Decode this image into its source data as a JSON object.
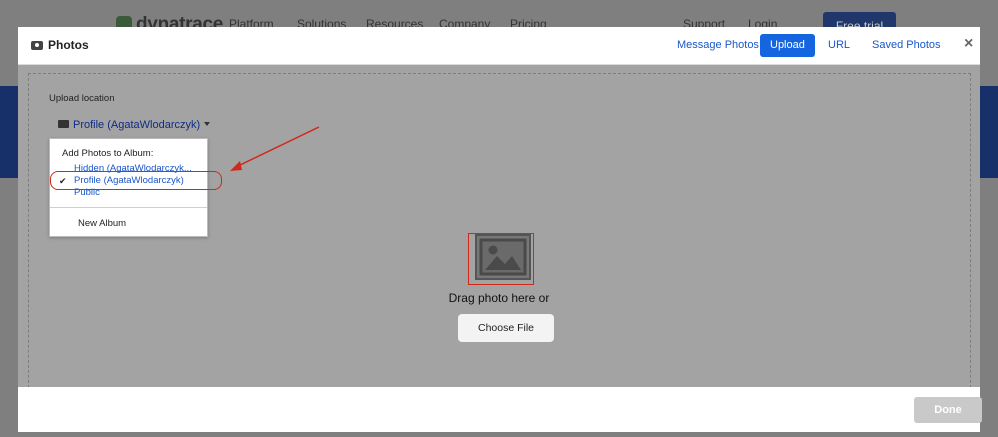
{
  "background": {
    "logo": "dynatrace",
    "nav": [
      "Platform",
      "Solutions",
      "Resources",
      "Company",
      "Pricing",
      "Support",
      "Login"
    ],
    "trial_button": "Free trial"
  },
  "modal": {
    "title": "Photos",
    "tabs": [
      "Message Photos",
      "Upload",
      "URL",
      "Saved Photos"
    ],
    "active_tab": "Upload",
    "close_icon": "×",
    "upload_location_label": "Upload location",
    "selected_album": "Profile (AgataWlodarczyk)",
    "dropdown": {
      "heading": "Add Photos to Album:",
      "items": [
        "Hidden (AgataWlodarczyk...",
        "Profile (AgataWlodarczyk)",
        "Public"
      ],
      "checked_item": "Profile (AgataWlodarczyk)",
      "check_mark": "✔",
      "new_album": "New Album"
    },
    "drag_text": "Drag photo here or",
    "choose_file": "Choose File",
    "done": "Done"
  },
  "colors": {
    "accent": "#1565e0",
    "annotation": "#d0281a",
    "overlay_gray": "#a3a3a3"
  }
}
